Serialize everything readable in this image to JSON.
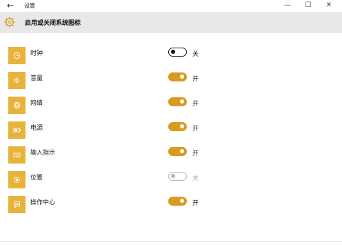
{
  "window": {
    "title": "设置",
    "back_glyph": "←",
    "minimize_glyph": "—",
    "maximize_glyph": "☐",
    "close_glyph": "✕"
  },
  "header": {
    "title": "启用或关闭系统图标",
    "icon": "gear-icon"
  },
  "accent_color": "#d79b1f",
  "icon_tile_color": "#e8b33b",
  "items": [
    {
      "label": "时钟",
      "icon": "clock-icon",
      "state": "off",
      "state_label": "关",
      "enabled": true
    },
    {
      "label": "音量",
      "icon": "volume-icon",
      "state": "on",
      "state_label": "开",
      "enabled": true
    },
    {
      "label": "网络",
      "icon": "network-icon",
      "state": "on",
      "state_label": "开",
      "enabled": true
    },
    {
      "label": "电源",
      "icon": "battery-icon",
      "state": "on",
      "state_label": "开",
      "enabled": true
    },
    {
      "label": "输入指示",
      "icon": "keyboard-icon",
      "state": "on",
      "state_label": "开",
      "enabled": true
    },
    {
      "label": "位置",
      "icon": "location-icon",
      "state": "off",
      "state_label": "关",
      "enabled": false
    },
    {
      "label": "操作中心",
      "icon": "action-center-icon",
      "state": "on",
      "state_label": "开",
      "enabled": true
    }
  ]
}
